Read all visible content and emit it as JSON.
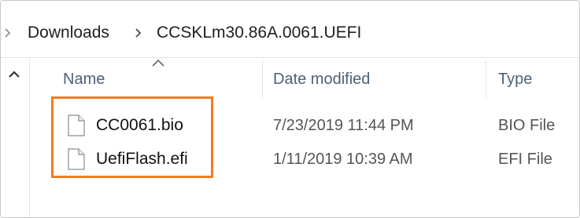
{
  "breadcrumb": {
    "items": [
      "Downloads",
      "CCSKLm30.86A.0061.UEFI"
    ]
  },
  "columns": {
    "name": "Name",
    "date_modified": "Date modified",
    "type": "Type"
  },
  "files": [
    {
      "name": "CC0061.bio",
      "date": "7/23/2019 11:44 PM",
      "type": "BIO File"
    },
    {
      "name": "UefiFlash.efi",
      "date": "1/11/2019 10:39 AM",
      "type": "EFI File"
    }
  ],
  "colors": {
    "highlight": "#f07d20",
    "header_text": "#4c607a"
  },
  "icons": {
    "nav_back": "chevron-right-icon",
    "collapse": "chevron-up-icon",
    "sort": "sort-ascending-icon",
    "file": "blank-file-icon"
  }
}
